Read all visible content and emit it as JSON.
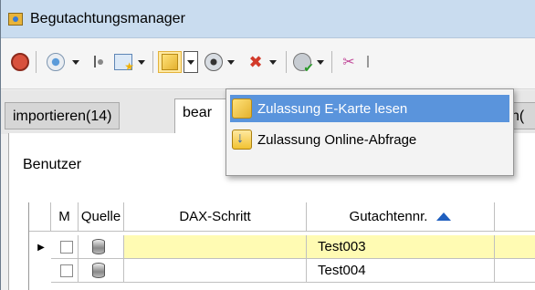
{
  "window": {
    "title": "Begutachtungsmanager"
  },
  "tabs": [
    {
      "label": "importieren(14)"
    },
    {
      "label": "bear"
    },
    {
      "label": "n("
    }
  ],
  "panel": {
    "user_label": "Benutzer"
  },
  "grid": {
    "columns": [
      "M",
      "Quelle",
      "DAX-Schritt",
      "Gutachtennr."
    ],
    "sort_icon": "sort-ascending-icon",
    "rows": [
      {
        "gutachtennr": "Test003",
        "selected": true
      },
      {
        "gutachtennr": "Test004",
        "selected": false
      }
    ]
  },
  "dropdown": {
    "items": [
      {
        "label": "Zulassung E-Karte lesen",
        "highlighted": true,
        "icon": "sim-card-icon"
      },
      {
        "label": "Zulassung Online-Abfrage",
        "highlighted": false,
        "icon": "online-query-icon"
      }
    ]
  },
  "colors": {
    "titlebar": "#c9dcef",
    "highlight": "#5a94dc",
    "selected_row": "#fffbb3"
  }
}
